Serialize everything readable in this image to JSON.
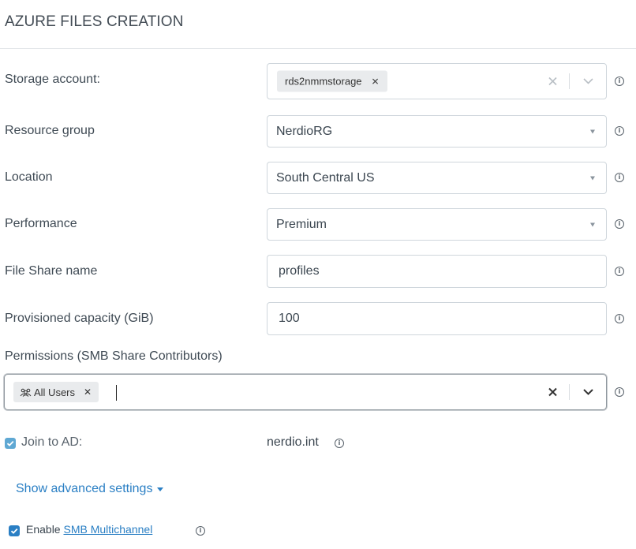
{
  "title": "AZURE FILES CREATION",
  "fields": {
    "storage_account": {
      "label": "Storage account:",
      "tag": "rds2nmmstorage"
    },
    "resource_group": {
      "label": "Resource group",
      "value": "NerdioRG"
    },
    "location": {
      "label": "Location",
      "value": "South Central US"
    },
    "performance": {
      "label": "Performance",
      "value": "Premium"
    },
    "file_share_name": {
      "label": "File Share name",
      "value": "profiles"
    },
    "provisioned_capacity": {
      "label": "Provisioned capacity (GiB)",
      "value": "100"
    }
  },
  "permissions": {
    "label": "Permissions (SMB Share Contributors)",
    "tag": "All Users"
  },
  "join_ad": {
    "label": "Join to AD:",
    "value": "nerdio.int",
    "checked": true
  },
  "advanced_link": "Show advanced settings",
  "smb": {
    "prefix": "Enable",
    "link": "SMB Multichannel",
    "checked": true
  },
  "icons": {
    "info": "info-icon",
    "caret": "caret-down-icon",
    "clear": "clear-x-icon",
    "chevron": "chevron-down-icon",
    "users": "users-group-icon",
    "check": "check-icon"
  },
  "colors": {
    "accent": "#2a7fc4",
    "checkbox_disabled": "#5fa8d3",
    "checkbox_active": "#2a7fc4",
    "border": "#cfd6dc"
  }
}
